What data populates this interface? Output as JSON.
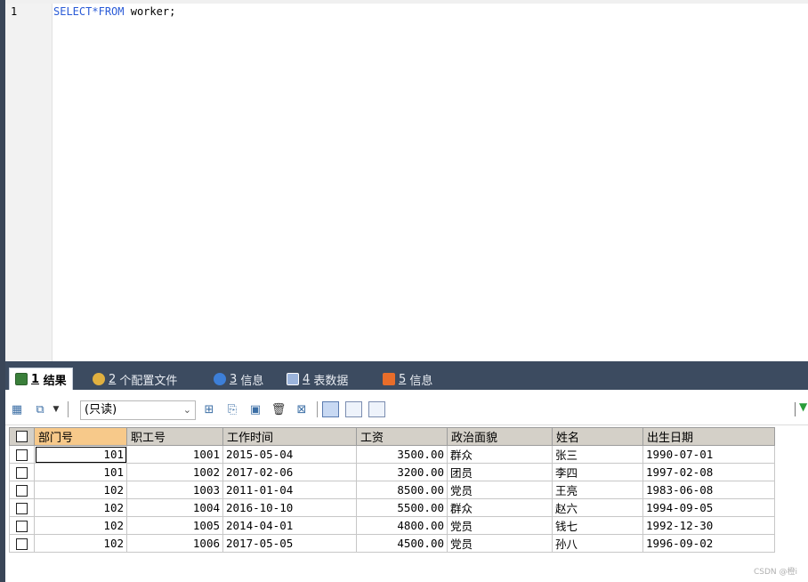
{
  "editor": {
    "line_number": "1",
    "code": {
      "kw1": "SELECT",
      "star": "*",
      "kw2": "FROM",
      "rest": " worker;"
    }
  },
  "tabs": [
    {
      "num": "1",
      "label": "结果",
      "active": true,
      "icon": "grid-result-icon",
      "color": "#3a7f3a"
    },
    {
      "num": "2",
      "label": "个配置文件",
      "active": false,
      "icon": "profile-icon",
      "color": "#e0b040"
    },
    {
      "num": "3",
      "label": "信息",
      "active": false,
      "icon": "info-icon",
      "color": "#3d7fd8"
    },
    {
      "num": "4",
      "label": "表数据",
      "active": false,
      "icon": "table-data-icon",
      "color": "#9bb4dc"
    },
    {
      "num": "5",
      "label": "信息",
      "active": false,
      "icon": "chart-info-icon",
      "color": "#e86d2a"
    }
  ],
  "toolbar": {
    "readonly_label": "(只读)"
  },
  "grid": {
    "columns": [
      "部门号",
      "职工号",
      "工作时间",
      "工资",
      "政治面貌",
      "姓名",
      "出生日期"
    ],
    "rows": [
      [
        "101",
        "1001",
        "2015-05-04",
        "3500.00",
        "群众",
        "张三",
        "1990-07-01"
      ],
      [
        "101",
        "1002",
        "2017-02-06",
        "3200.00",
        "团员",
        "李四",
        "1997-02-08"
      ],
      [
        "102",
        "1003",
        "2011-01-04",
        "8500.00",
        "党员",
        "王亮",
        "1983-06-08"
      ],
      [
        "102",
        "1004",
        "2016-10-10",
        "5500.00",
        "群众",
        "赵六",
        "1994-09-05"
      ],
      [
        "102",
        "1005",
        "2014-04-01",
        "4800.00",
        "党员",
        "钱七",
        "1992-12-30"
      ],
      [
        "102",
        "1006",
        "2017-05-05",
        "4500.00",
        "党员",
        "孙八",
        "1996-09-02"
      ]
    ]
  },
  "watermark": "CSDN @橙i"
}
